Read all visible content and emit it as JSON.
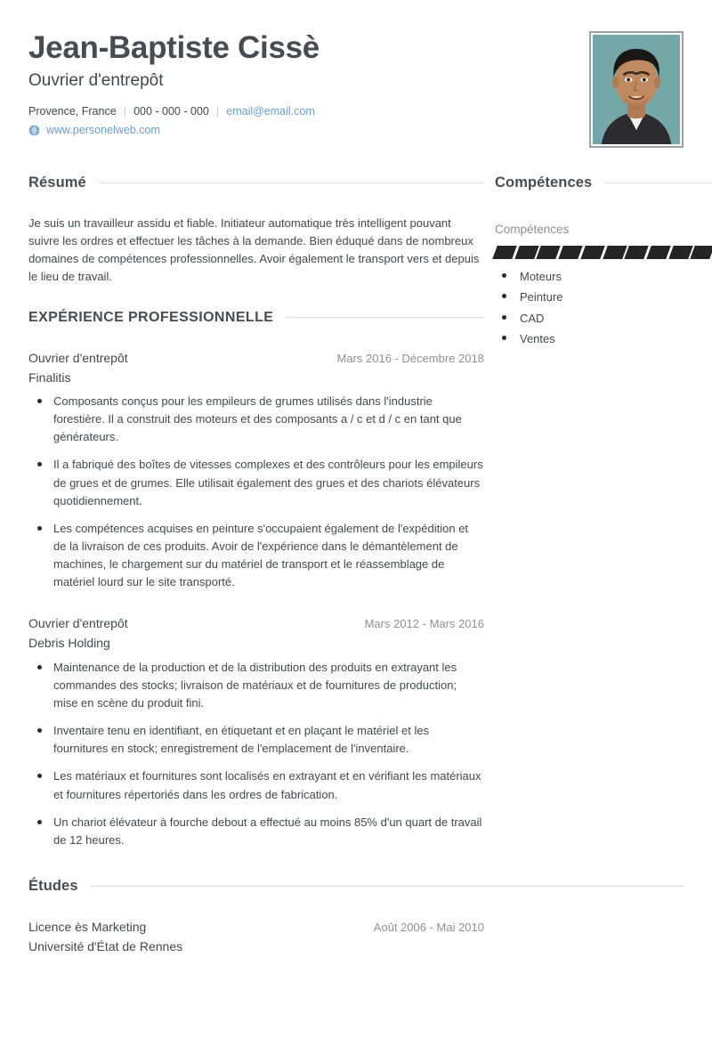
{
  "header": {
    "full_name": "Jean-Baptiste Cissè",
    "job_title": "Ouvrier d'entrepôt",
    "location": "Provence, France",
    "phone": "000 - 000 - 000",
    "email": "email@email.com",
    "website": "www.personelweb.com",
    "separator": "|",
    "photo_alt": "portrait-photo",
    "colors": {
      "link": "#6a9fd0",
      "heading": "#454d52",
      "text": "#3f4a4f",
      "muted": "#8b9195",
      "rule": "#d8dadc",
      "skill_filled": "#242424",
      "photo_background": "#6fa8a8"
    }
  },
  "summary": {
    "heading": "Résumé",
    "text": "Je suis un travailleur assidu et fiable. Initiateur automatique très intelligent pouvant suivre les ordres et effectuer les tâches à la demande. Bien éduqué dans de nombreux domaines de compétences professionnelles. Avoir également le transport vers et depuis le lieu de travail."
  },
  "experience": {
    "heading": "EXPÉRIENCE PROFESSIONNELLE",
    "entries": [
      {
        "title": "Ouvrier d'entrepôt",
        "date": "Mars 2016 - Décembre 2018",
        "organization": "Finalitis",
        "bullets": [
          "Composants conçus pour les empileurs de grumes utilisés dans l'industrie forestière. Il a construit des moteurs et des composants a / c et d / c en tant que générateurs.",
          "Il a fabriqué des boîtes de vitesses complexes et des contrôleurs pour les empileurs de grues et de grumes. Elle utilisait également des grues et des chariots élévateurs quotidiennement.",
          "Les compétences acquises en peinture s'occupaient également de l'expédition et de la livraison de ces produits. Avoir de l'expérience dans le démantèlement de machines, le chargement sur du matériel de transport et le réassemblage de matériel lourd sur le site transporté."
        ]
      },
      {
        "title": "Ouvrier d'entrepôt",
        "date": "Mars 2012 - Mars 2016",
        "organization": "Debris Holding",
        "bullets": [
          "Maintenance de la production et de la distribution des produits en extrayant les commandes des stocks; livraison de matériaux et de fournitures de production; mise en scène du produit fini.",
          "Inventaire tenu en identifiant, en étiquetant et en plaçant le matériel et les fournitures en stock; enregistrement de l'emplacement de l'inventaire.",
          "Les matériaux et fournitures sont localisés en extrayant et en vérifiant les matériaux et fournitures répertoriés dans les ordres de fabrication.",
          "Un chariot élévateur à fourche debout a effectué au moins 85% d'un quart de travail de 12 heures."
        ]
      }
    ]
  },
  "education": {
    "heading": "Études",
    "entries": [
      {
        "title": "Licence ès Marketing",
        "date": "Août 2006 - Mai 2010",
        "organization": "Université d'État de Rennes"
      }
    ]
  },
  "skills": {
    "heading": "Compétences",
    "group_label": "Compétences",
    "rating_total": 10,
    "rating_filled": 10,
    "items": [
      {
        "label": "Moteurs"
      },
      {
        "label": "Peinture"
      },
      {
        "label": "CAD"
      },
      {
        "label": "Ventes"
      }
    ]
  }
}
